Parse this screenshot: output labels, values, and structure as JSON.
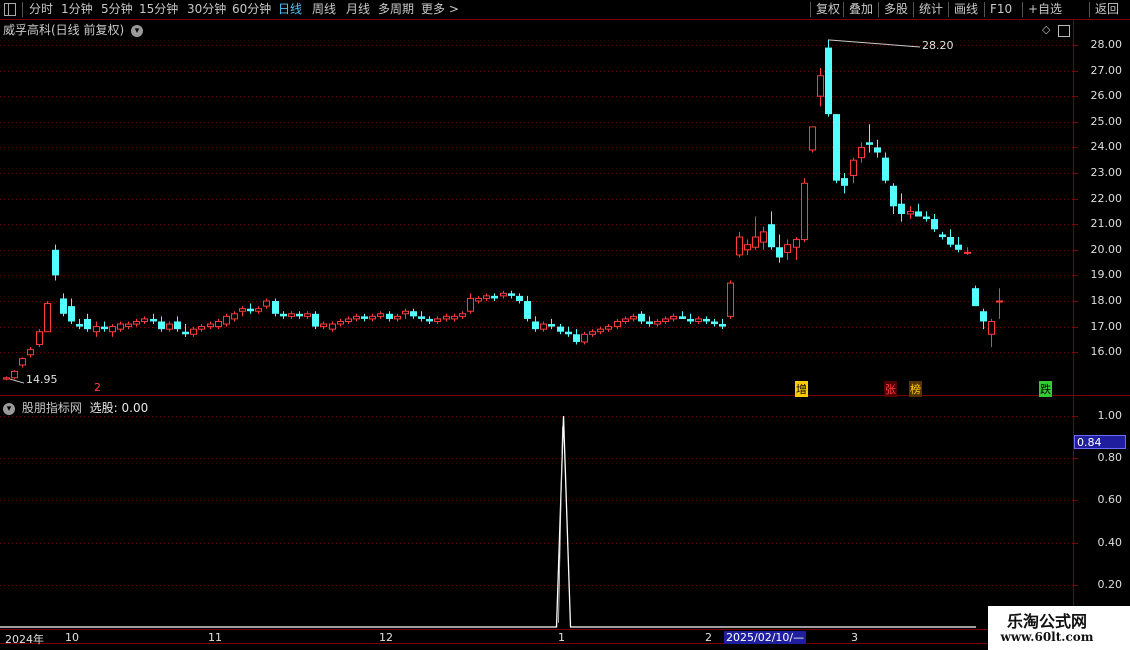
{
  "toolbar": {
    "left": [
      "分时",
      "1分钟",
      "5分钟",
      "15分钟",
      "30分钟",
      "60分钟",
      "日线",
      "周线",
      "月线",
      "多周期",
      "更多 >"
    ],
    "active": "日线",
    "right": [
      "复权",
      "叠加",
      "多股",
      "统计",
      "画线",
      "F10",
      "+自选",
      "返回"
    ]
  },
  "main_header": {
    "title": "威孚高科(日线 前复权)"
  },
  "indicator_header": {
    "name": "股朋指标网",
    "value_text": "选股: 0.00"
  },
  "price_axis": {
    "ticks": [
      "28.00",
      "27.00",
      "26.00",
      "25.00",
      "24.00",
      "23.00",
      "22.00",
      "21.00",
      "20.00",
      "19.00",
      "18.00",
      "17.00",
      "16.00"
    ]
  },
  "indicator_axis": {
    "ticks": [
      "1.00",
      "0.80",
      "0.60",
      "0.40",
      "0.20"
    ],
    "current": "0.84"
  },
  "annotations": {
    "high": "28.20",
    "low": "14.95"
  },
  "markers": {
    "m1": "增",
    "m2": "张",
    "m3": "榜",
    "m4": "跌",
    "m5": "2"
  },
  "date_axis": {
    "year": "2024年",
    "months": [
      "10",
      "11",
      "12",
      "1",
      "2",
      "3"
    ],
    "cursor": "2025/02/10/—"
  },
  "watermark": {
    "line1": "乐淘公式网",
    "line2": "www.60lt.com"
  },
  "colors": {
    "up": "#ff3b3b",
    "down": "#54ffff",
    "grid": "#7a0000",
    "signal": "#ffffff"
  },
  "chart_data": {
    "type": "candlestick",
    "price_range": [
      15.5,
      28.6
    ],
    "candles": [
      [
        14.95,
        15.05,
        14.9,
        15.0
      ],
      [
        15.0,
        15.3,
        14.95,
        15.25
      ],
      [
        15.5,
        15.8,
        15.4,
        15.75
      ],
      [
        15.9,
        16.2,
        15.8,
        16.1
      ],
      [
        16.3,
        16.9,
        16.2,
        16.8
      ],
      [
        16.8,
        18.0,
        16.8,
        17.9
      ],
      [
        20.0,
        20.2,
        18.8,
        19.0
      ],
      [
        18.1,
        18.3,
        17.4,
        17.5
      ],
      [
        17.8,
        18.1,
        17.1,
        17.2
      ],
      [
        17.1,
        17.3,
        16.9,
        17.0
      ],
      [
        17.3,
        17.5,
        16.8,
        16.9
      ],
      [
        16.8,
        17.2,
        16.6,
        17.0
      ],
      [
        17.0,
        17.2,
        16.8,
        16.9
      ],
      [
        16.8,
        17.1,
        16.6,
        17.0
      ],
      [
        16.9,
        17.2,
        16.8,
        17.1
      ],
      [
        17.0,
        17.2,
        16.9,
        17.1
      ],
      [
        17.1,
        17.3,
        17.0,
        17.2
      ],
      [
        17.2,
        17.4,
        17.1,
        17.3
      ],
      [
        17.3,
        17.5,
        17.1,
        17.2
      ],
      [
        17.2,
        17.4,
        16.8,
        16.9
      ],
      [
        16.9,
        17.2,
        16.8,
        17.1
      ],
      [
        17.2,
        17.4,
        16.8,
        16.9
      ],
      [
        16.8,
        17.1,
        16.6,
        16.7
      ],
      [
        16.7,
        17.0,
        16.6,
        16.9
      ],
      [
        16.9,
        17.1,
        16.8,
        17.0
      ],
      [
        17.0,
        17.2,
        16.9,
        17.1
      ],
      [
        17.0,
        17.3,
        16.9,
        17.2
      ],
      [
        17.1,
        17.5,
        17.0,
        17.4
      ],
      [
        17.3,
        17.6,
        17.2,
        17.5
      ],
      [
        17.6,
        17.8,
        17.4,
        17.7
      ],
      [
        17.7,
        17.9,
        17.5,
        17.6
      ],
      [
        17.6,
        17.8,
        17.5,
        17.7
      ],
      [
        17.8,
        18.1,
        17.7,
        18.0
      ],
      [
        18.0,
        18.1,
        17.4,
        17.5
      ],
      [
        17.5,
        17.6,
        17.3,
        17.4
      ],
      [
        17.4,
        17.6,
        17.3,
        17.5
      ],
      [
        17.5,
        17.6,
        17.3,
        17.4
      ],
      [
        17.4,
        17.6,
        17.3,
        17.5
      ],
      [
        17.5,
        17.6,
        16.9,
        17.0
      ],
      [
        17.0,
        17.2,
        16.9,
        17.1
      ],
      [
        16.9,
        17.2,
        16.8,
        17.1
      ],
      [
        17.1,
        17.3,
        17.0,
        17.2
      ],
      [
        17.2,
        17.4,
        17.1,
        17.3
      ],
      [
        17.3,
        17.5,
        17.2,
        17.4
      ],
      [
        17.4,
        17.5,
        17.2,
        17.3
      ],
      [
        17.3,
        17.5,
        17.2,
        17.4
      ],
      [
        17.4,
        17.6,
        17.3,
        17.5
      ],
      [
        17.5,
        17.6,
        17.2,
        17.3
      ],
      [
        17.3,
        17.5,
        17.2,
        17.4
      ],
      [
        17.5,
        17.7,
        17.3,
        17.6
      ],
      [
        17.6,
        17.7,
        17.3,
        17.4
      ],
      [
        17.4,
        17.6,
        17.2,
        17.3
      ],
      [
        17.3,
        17.4,
        17.1,
        17.2
      ],
      [
        17.2,
        17.4,
        17.1,
        17.3
      ],
      [
        17.3,
        17.5,
        17.2,
        17.4
      ],
      [
        17.3,
        17.5,
        17.2,
        17.4
      ],
      [
        17.4,
        17.6,
        17.3,
        17.5
      ],
      [
        17.6,
        18.3,
        17.5,
        18.1
      ],
      [
        18.0,
        18.2,
        17.9,
        18.1
      ],
      [
        18.1,
        18.3,
        18.0,
        18.2
      ],
      [
        18.2,
        18.3,
        18.0,
        18.1
      ],
      [
        18.2,
        18.4,
        18.1,
        18.3
      ],
      [
        18.3,
        18.4,
        18.1,
        18.2
      ],
      [
        18.2,
        18.3,
        17.9,
        18.0
      ],
      [
        18.0,
        18.2,
        17.2,
        17.3
      ],
      [
        17.2,
        17.4,
        16.8,
        16.9
      ],
      [
        16.9,
        17.2,
        16.8,
        17.1
      ],
      [
        17.1,
        17.3,
        16.9,
        17.0
      ],
      [
        17.0,
        17.1,
        16.7,
        16.8
      ],
      [
        16.8,
        17.0,
        16.6,
        16.7
      ],
      [
        16.7,
        16.9,
        16.3,
        16.4
      ],
      [
        16.4,
        16.8,
        16.3,
        16.7
      ],
      [
        16.7,
        16.9,
        16.6,
        16.8
      ],
      [
        16.8,
        17.0,
        16.7,
        16.9
      ],
      [
        16.9,
        17.1,
        16.8,
        17.0
      ],
      [
        17.0,
        17.3,
        16.9,
        17.2
      ],
      [
        17.2,
        17.4,
        17.1,
        17.3
      ],
      [
        17.3,
        17.5,
        17.2,
        17.4
      ],
      [
        17.5,
        17.6,
        17.1,
        17.2
      ],
      [
        17.2,
        17.4,
        17.0,
        17.1
      ],
      [
        17.1,
        17.3,
        17.0,
        17.2
      ],
      [
        17.2,
        17.4,
        17.1,
        17.3
      ],
      [
        17.3,
        17.5,
        17.2,
        17.4
      ],
      [
        17.4,
        17.6,
        17.3,
        17.3
      ],
      [
        17.3,
        17.5,
        17.1,
        17.2
      ],
      [
        17.2,
        17.4,
        17.1,
        17.3
      ],
      [
        17.3,
        17.4,
        17.1,
        17.2
      ],
      [
        17.2,
        17.3,
        17.0,
        17.1
      ],
      [
        17.1,
        17.3,
        16.9,
        17.0
      ],
      [
        17.4,
        18.8,
        17.3,
        18.7
      ],
      [
        19.8,
        20.7,
        19.7,
        20.5
      ],
      [
        20.0,
        20.4,
        19.8,
        20.2
      ],
      [
        20.1,
        21.3,
        20.0,
        20.5
      ],
      [
        20.3,
        20.9,
        20.0,
        20.7
      ],
      [
        21.0,
        21.5,
        20.0,
        20.1
      ],
      [
        20.1,
        20.6,
        19.5,
        19.7
      ],
      [
        19.9,
        20.4,
        19.6,
        20.2
      ],
      [
        20.1,
        20.5,
        19.6,
        20.4
      ],
      [
        20.4,
        22.8,
        20.3,
        22.6
      ],
      [
        23.9,
        24.8,
        23.8,
        24.8
      ],
      [
        26.0,
        27.1,
        25.6,
        26.8
      ],
      [
        27.9,
        28.2,
        25.2,
        25.3
      ],
      [
        25.3,
        25.3,
        22.6,
        22.7
      ],
      [
        22.8,
        23.0,
        22.2,
        22.5
      ],
      [
        22.9,
        23.6,
        22.6,
        23.5
      ],
      [
        23.6,
        24.2,
        23.4,
        24.0
      ],
      [
        24.2,
        24.9,
        23.8,
        24.1
      ],
      [
        24.0,
        24.3,
        23.6,
        23.8
      ],
      [
        23.6,
        23.8,
        22.6,
        22.7
      ],
      [
        22.5,
        22.6,
        21.4,
        21.7
      ],
      [
        21.8,
        22.2,
        21.1,
        21.4
      ],
      [
        21.4,
        21.7,
        21.2,
        21.5
      ],
      [
        21.5,
        21.8,
        21.3,
        21.3
      ],
      [
        21.3,
        21.5,
        21.1,
        21.2
      ],
      [
        21.2,
        21.4,
        20.7,
        20.8
      ],
      [
        20.6,
        20.7,
        20.4,
        20.5
      ],
      [
        20.5,
        20.8,
        20.1,
        20.2
      ],
      [
        20.2,
        20.5,
        19.9,
        20.0
      ],
      [
        19.9,
        20.1,
        19.8,
        19.9
      ],
      [
        18.5,
        18.6,
        17.8,
        17.8
      ],
      [
        17.6,
        17.7,
        16.9,
        17.2
      ],
      [
        16.7,
        17.3,
        16.2,
        17.2
      ],
      [
        18.0,
        18.5,
        17.3,
        18.0
      ]
    ],
    "indicator": {
      "name": "选股",
      "range": [
        0,
        1.05
      ],
      "spike_index": 68,
      "spike_value": 1.0
    }
  }
}
